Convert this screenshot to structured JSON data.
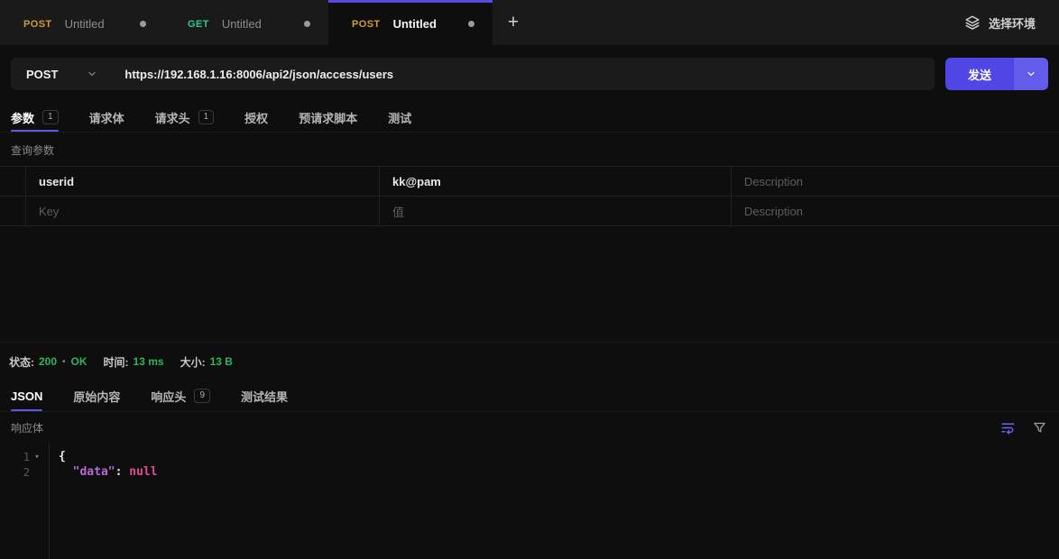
{
  "colors": {
    "accent_purple": "#554be0",
    "send_button": "#4f46e5",
    "method_post": "#d29a3a",
    "method_get": "#2fc98c",
    "success_green": "#2db55d",
    "json_key": "#b36bd4",
    "json_null": "#e04a93"
  },
  "icons": {
    "environment": "layers-icon",
    "method_select": "chevron-down-icon",
    "send_options": "chevron-down-icon",
    "add_tab": "plus-icon",
    "word_wrap": "word-wrap-icon",
    "filter": "filter-funnel-icon",
    "code_fold": "fold-caret-icon",
    "unsaved": "unsaved-dot-icon"
  },
  "tabbar": {
    "tabs": [
      {
        "method": "POST",
        "title": "Untitled"
      },
      {
        "method": "GET",
        "title": "Untitled"
      },
      {
        "method": "POST",
        "title": "Untitled"
      }
    ],
    "add_label": "+",
    "env_label": "选择环境"
  },
  "request": {
    "method": "POST",
    "url": "https://192.168.1.16:8006/api2/json/access/users",
    "send_label": "发送"
  },
  "request_tabs": {
    "params": {
      "label": "参数",
      "badge": "1"
    },
    "body": {
      "label": "请求体"
    },
    "headers": {
      "label": "请求头",
      "badge": "1"
    },
    "auth": {
      "label": "授权"
    },
    "prescript": {
      "label": "预请求脚本"
    },
    "tests": {
      "label": "测试"
    }
  },
  "query_params": {
    "title": "查询参数",
    "rows": [
      {
        "key": "userid",
        "value": "kk@pam",
        "description_placeholder": "Description"
      },
      {
        "key_placeholder": "Key",
        "value_placeholder": "值",
        "description_placeholder": "Description"
      }
    ]
  },
  "response_meta": {
    "status_label": "状态:",
    "status_code": "200",
    "bullet": "•",
    "status_text": "OK",
    "time_label": "时间:",
    "time_value": "13 ms",
    "size_label": "大小:",
    "size_value": "13 B"
  },
  "response_tabs": {
    "json": {
      "label": "JSON"
    },
    "raw": {
      "label": "原始内容"
    },
    "headers": {
      "label": "响应头",
      "badge": "9"
    },
    "tests": {
      "label": "测试结果"
    }
  },
  "response_body": {
    "title": "响应体",
    "lines": [
      {
        "num": "1",
        "open": "{"
      },
      {
        "num": "2",
        "indent": "  ",
        "key": "\"data\"",
        "colon": ": ",
        "value": "null"
      }
    ]
  }
}
